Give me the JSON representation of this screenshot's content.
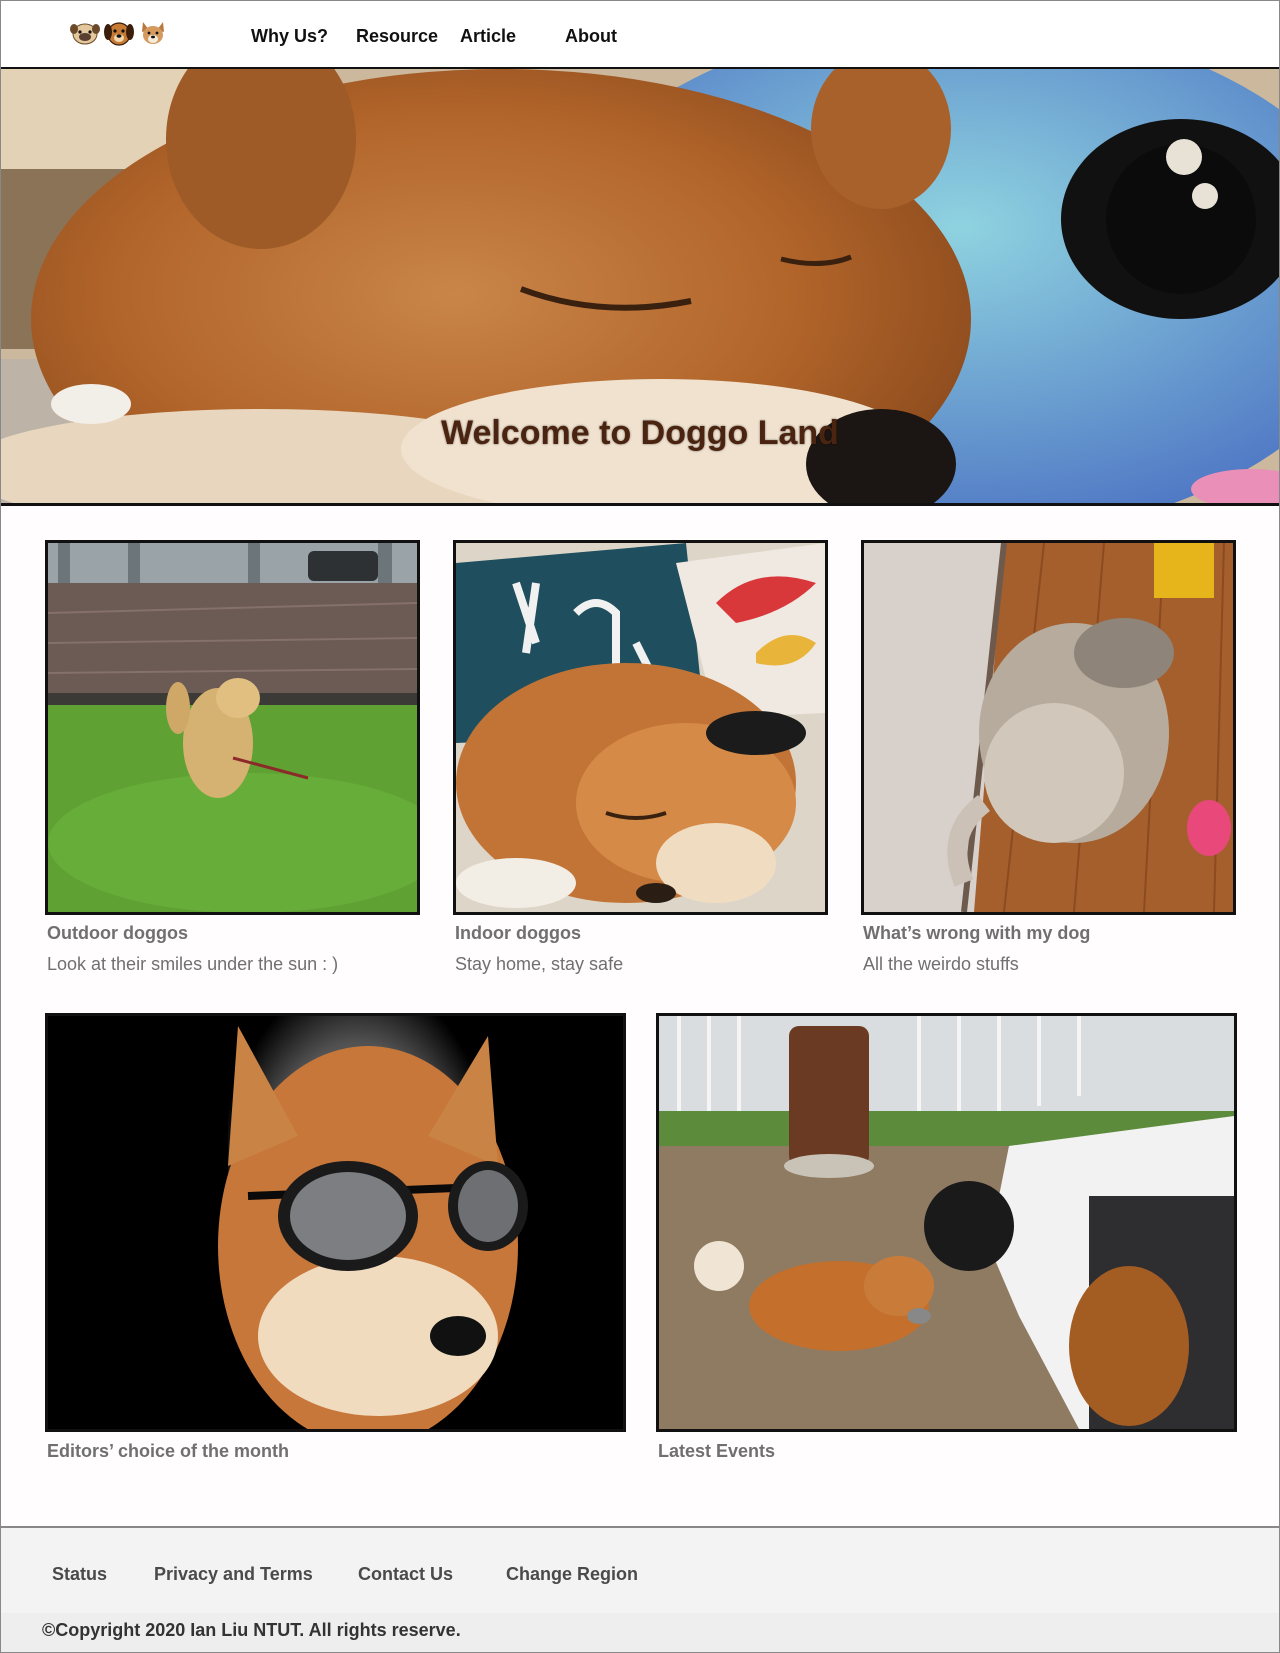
{
  "nav": {
    "logos": [
      {
        "icon": "pug-face-icon",
        "color": "#d7b487"
      },
      {
        "icon": "dog-face-icon",
        "color": "#b5652a"
      },
      {
        "icon": "collie-face-icon",
        "color": "#c58a4e"
      }
    ],
    "links": [
      "Why Us?",
      "Resource",
      "Article",
      "About"
    ]
  },
  "hero": {
    "title": "Welcome to Doggo Land",
    "image": "sleeping-shiba-with-plush-toy"
  },
  "cards": [
    {
      "title": "Outdoor doggos",
      "subtitle": "Look at their smiles under the sun : )",
      "image": "golden-retriever-on-grass"
    },
    {
      "title": "Indoor doggos",
      "subtitle": "Stay home, stay safe",
      "image": "shiba-sleeping-on-couch"
    },
    {
      "title": "What’s wrong with my dog",
      "subtitle": "All the weirdo stuffs",
      "image": "dog-lying-against-wall"
    }
  ],
  "features": [
    {
      "title": "Editors’ choice of the month",
      "image": "shiba-wearing-sunglasses"
    },
    {
      "title": "Latest Events",
      "image": "person-feeding-shiba-in-park"
    }
  ],
  "footer": {
    "links": [
      "Status",
      "Privacy and Terms",
      "Contact Us",
      "Change Region"
    ],
    "copyright": "©Copyright 2020 Ian Liu NTUT. All rights reserve."
  },
  "colors": {
    "border": "#111111",
    "text_muted": "#707070",
    "footer_bg": "#f3f3f3"
  }
}
